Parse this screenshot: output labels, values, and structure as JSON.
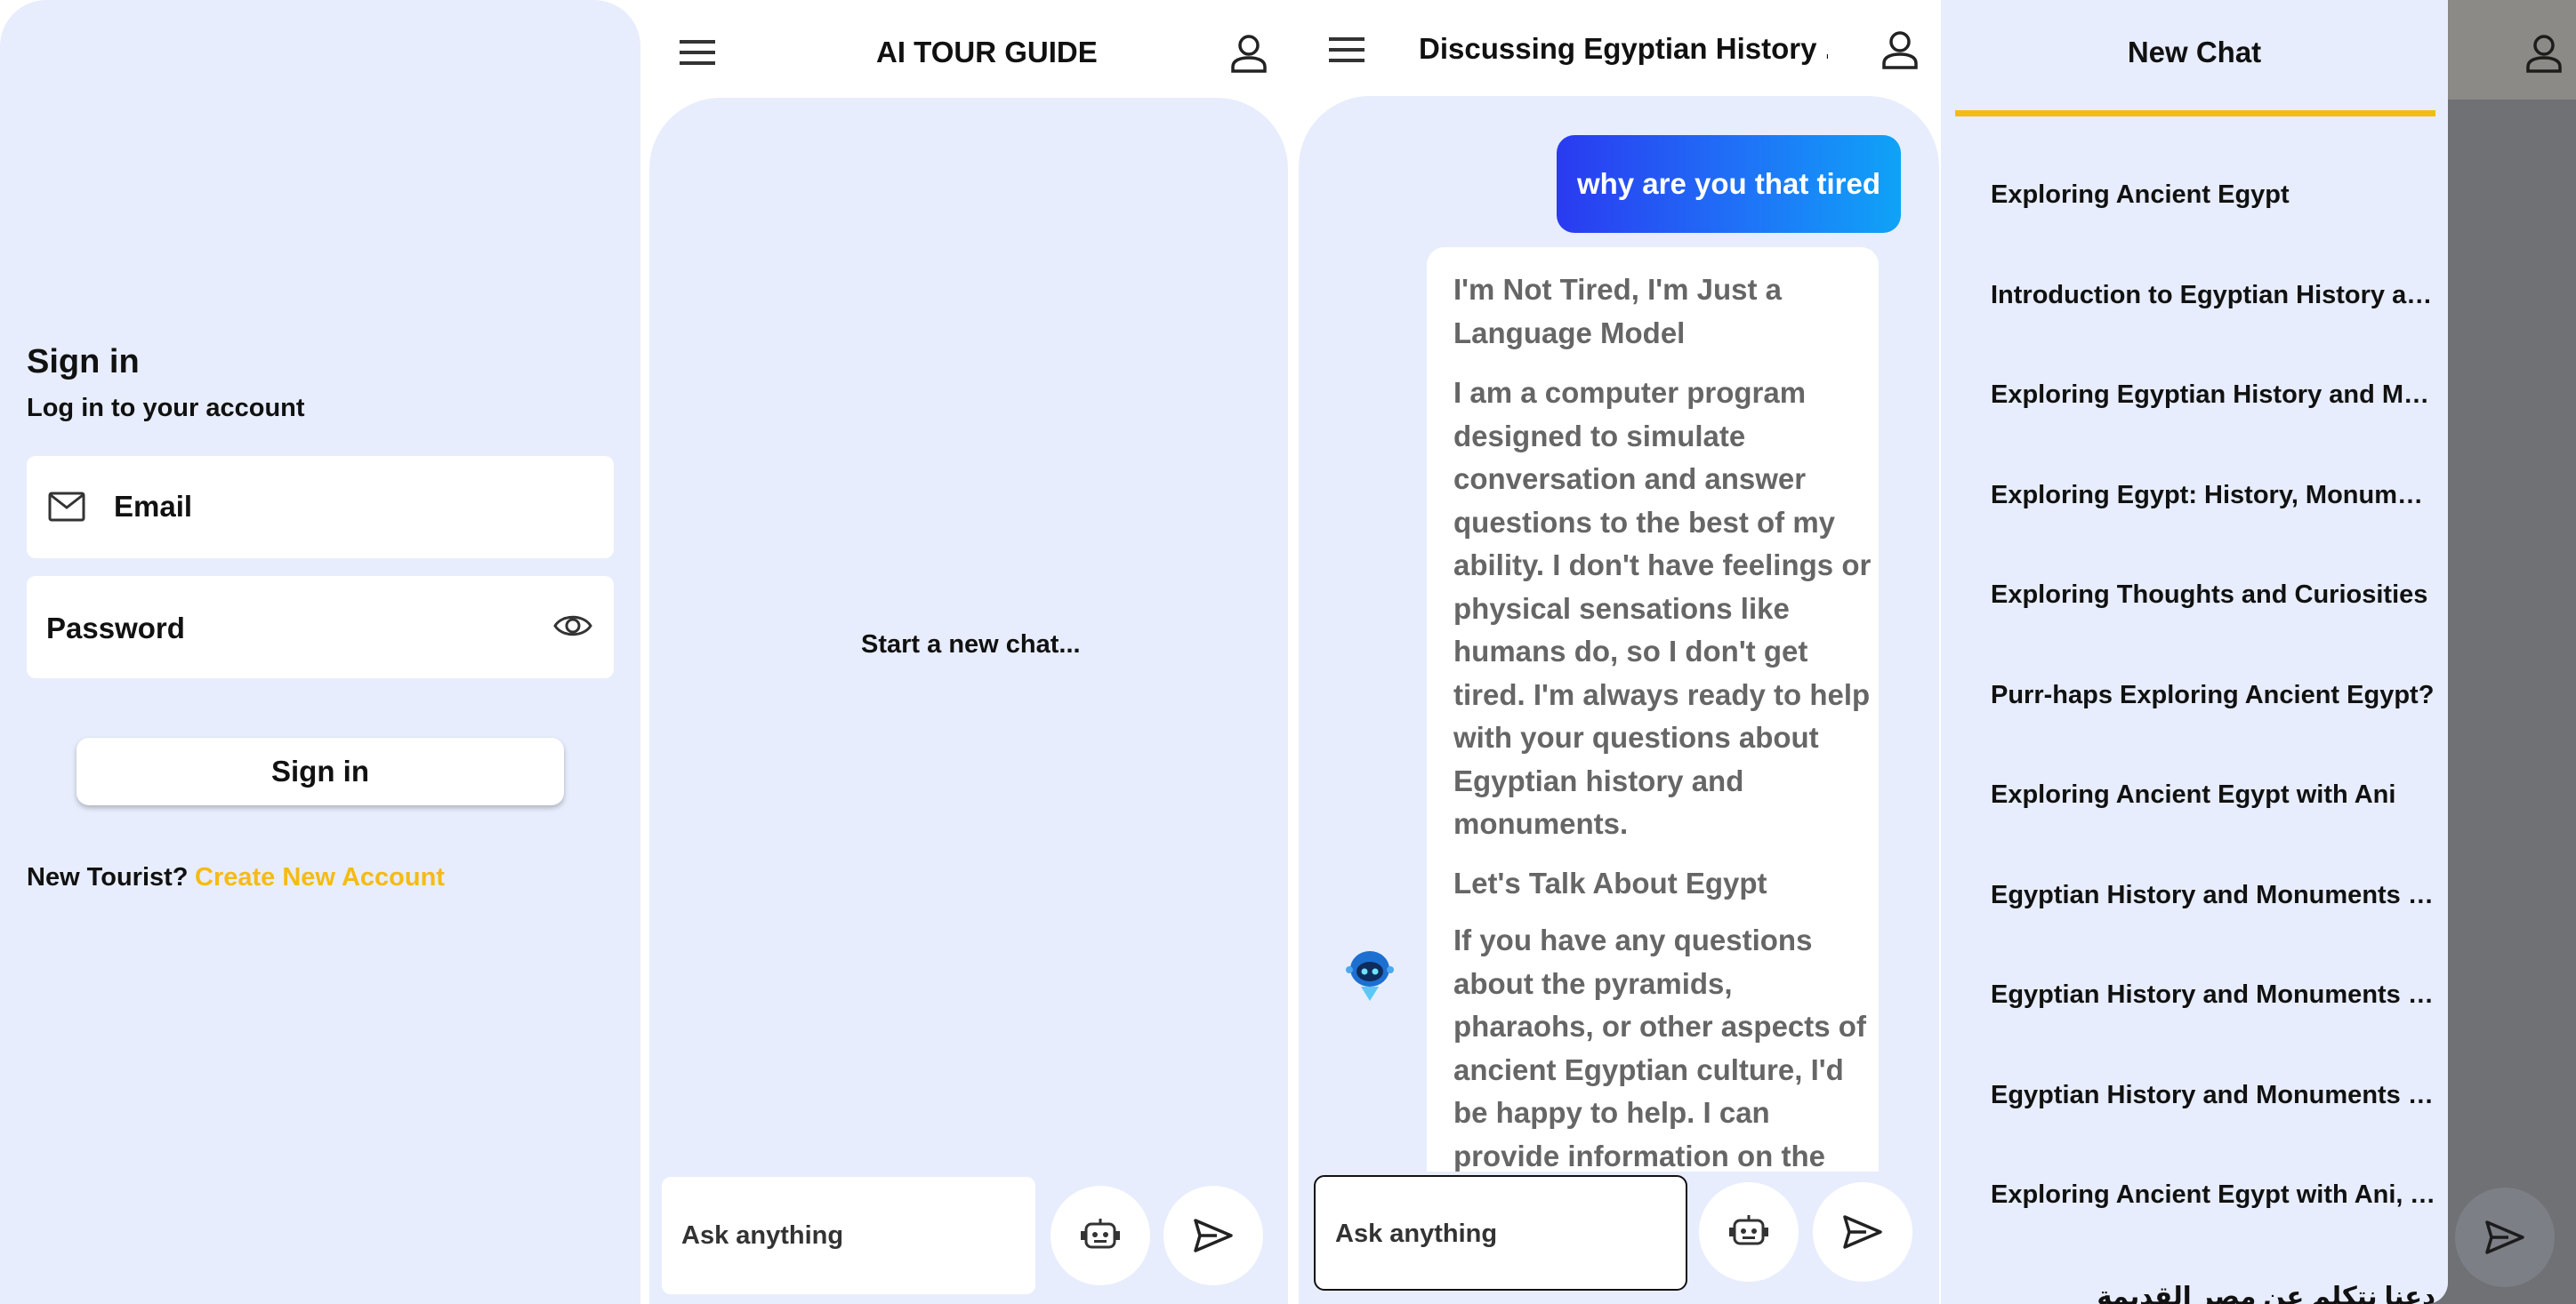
{
  "signin": {
    "title": "Sign in",
    "subtitle": "Log in to your account",
    "email_placeholder": "Email",
    "password_placeholder": "Password",
    "button": "Sign in",
    "new_tourist": "New Tourist?",
    "create_account": "Create New Account",
    "link_color": "#f5bb15"
  },
  "guide": {
    "title": "AI TOUR GUIDE",
    "empty_state": "Start a new chat...",
    "input_placeholder": "Ask anything"
  },
  "discussion": {
    "title": "Discussing Egyptian History ...",
    "user_message": "why are you that tired",
    "bot_heading_1": "I'm Not Tired, I'm Just a Language Model",
    "bot_paragraph_1": "I am a computer program designed to simulate conversation and answer questions to the best of my ability. I don't have feelings or physical sensations like humans do, so I don't get tired. I'm always ready to help with your questions about Egyptian history and monuments.",
    "bot_heading_2": "Let's Talk About Egypt",
    "bot_paragraph_2": "If you have any questions about the pyramids, pharaohs, or other aspects of ancient Egyptian culture, I'd be happy to help. I can provide information on the",
    "input_placeholder": "Ask anything"
  },
  "drawer": {
    "title": "New Chat",
    "accent": "#f5bb15",
    "items": [
      "Exploring Ancient Egypt",
      "Introduction to Egyptian History an...",
      "Exploring Egyptian History and Mon...",
      "Exploring Egypt: History, Monument...",
      "Exploring Thoughts and Curiosities",
      "Purr-haps Exploring Ancient Egypt?",
      "Exploring Ancient Egypt with Ani",
      "Egyptian History and Monuments T...",
      "Egyptian History and Monuments T...",
      "Egyptian History and Monuments T...",
      "Exploring Ancient Egypt with Ani, Y...",
      "دعنا نتكلم عن مصر القديمة"
    ]
  },
  "icons": {
    "menu": "hamburger-menu-icon",
    "profile": "person-icon",
    "email": "mail-icon",
    "visibility": "eye-icon",
    "robot": "robot-icon",
    "send": "send-icon",
    "bot_avatar": "robot-avatar-icon"
  }
}
